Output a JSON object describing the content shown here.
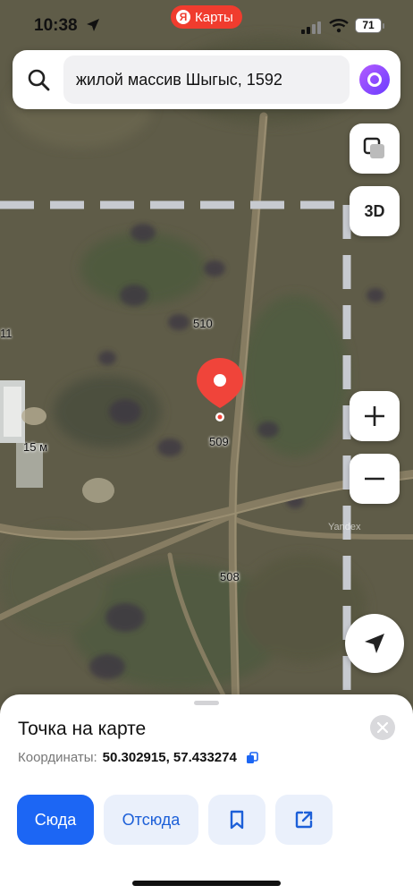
{
  "status_bar": {
    "time": "10:38",
    "battery": "71"
  },
  "brand": {
    "ya": "Я",
    "name": "Карты",
    "color": "#f03c2e"
  },
  "search": {
    "query": "жилой массив Шыгыс, 1592",
    "icon": "search-icon"
  },
  "map": {
    "controls": {
      "layers_icon": "layers-icon",
      "three_d_label": "3D",
      "zoom_in_icon": "plus-icon",
      "zoom_out_icon": "minus-icon",
      "locate_icon": "navigation-arrow-icon"
    },
    "labels": {
      "l510": "510",
      "l509": "509",
      "l508": "508",
      "l11": "11",
      "l15m": "15 м"
    },
    "watermark": "Yandex",
    "pin_color": "#f0443a"
  },
  "sheet": {
    "title": "Точка на карте",
    "coords_label": "Координаты:",
    "coords_value": "50.302915, 57.433274",
    "actions": {
      "here": "Сюда",
      "from": "Отсюда",
      "bookmark_icon": "bookmark-icon",
      "share_icon": "share-icon"
    },
    "accent": "#1c66f4"
  }
}
